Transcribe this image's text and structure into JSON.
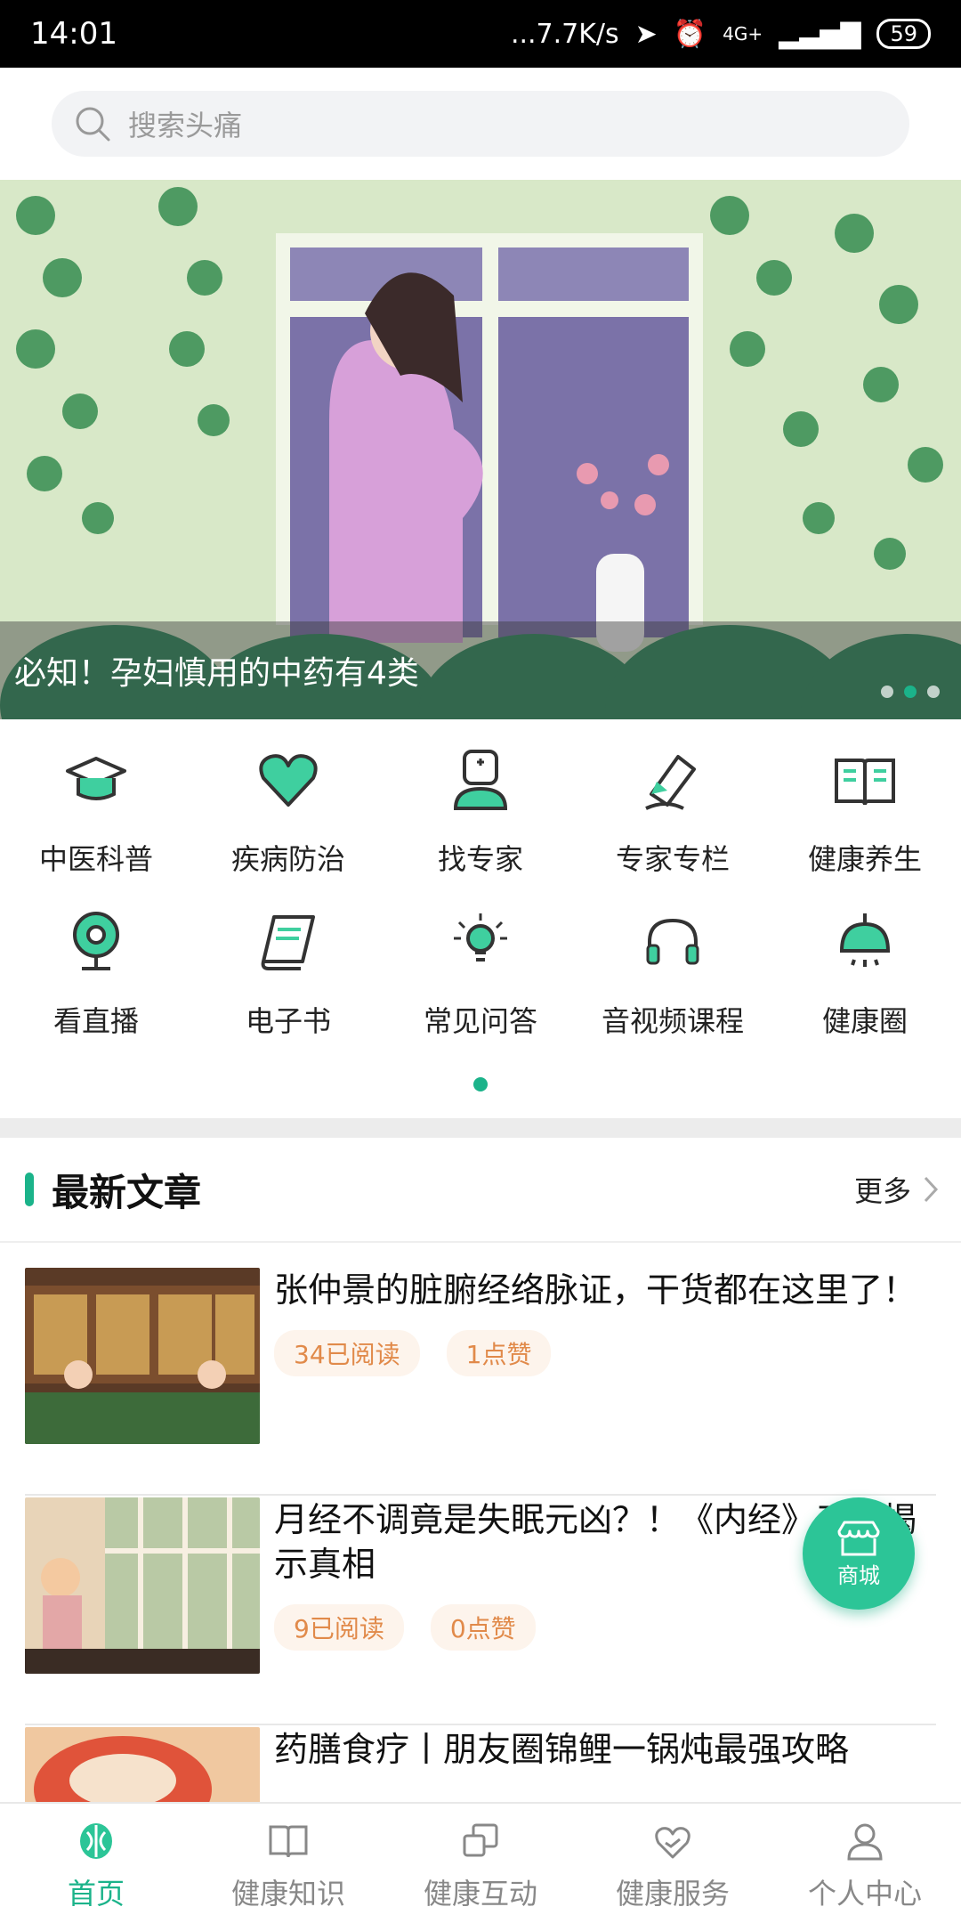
{
  "status_bar": {
    "time": "14:01",
    "network": "...7.7K/s",
    "signal": "4G+",
    "battery": "59"
  },
  "search": {
    "placeholder": "搜索头痛"
  },
  "banner": {
    "caption": "必知！孕妇慎用的中药有4类"
  },
  "categories": [
    {
      "label": "中医科普",
      "icon": "graduation-cap-icon"
    },
    {
      "label": "疾病防治",
      "icon": "heart-icon"
    },
    {
      "label": "找专家",
      "icon": "doctor-icon"
    },
    {
      "label": "专家专栏",
      "icon": "pen-icon"
    },
    {
      "label": "健康养生",
      "icon": "book-icon"
    },
    {
      "label": "看直播",
      "icon": "webcam-icon"
    },
    {
      "label": "电子书",
      "icon": "ebook-icon"
    },
    {
      "label": "常见问答",
      "icon": "lightbulb-icon"
    },
    {
      "label": "音视频课程",
      "icon": "headphones-icon"
    },
    {
      "label": "健康圈",
      "icon": "bell-lamp-icon"
    }
  ],
  "section": {
    "title": "最新文章",
    "more": "更多"
  },
  "articles": [
    {
      "title": "张仲景的脏腑经络脉证，干货都在这里了！",
      "reads": "34已阅读",
      "likes": "1点赞"
    },
    {
      "title": "月经不调竟是失眠元凶？！《内经》三法揭示真相",
      "reads": "9已阅读",
      "likes": "0点赞"
    },
    {
      "title": "药膳食疗丨朋友圈锦鲤一锅炖最强攻略"
    }
  ],
  "fab": {
    "label": "商城"
  },
  "tabbar": [
    {
      "label": "首页",
      "icon": "home-leaf-icon",
      "active": true
    },
    {
      "label": "健康知识",
      "icon": "open-book-icon"
    },
    {
      "label": "健康互动",
      "icon": "chat-squares-icon"
    },
    {
      "label": "健康服务",
      "icon": "heart-hand-icon"
    },
    {
      "label": "个人中心",
      "icon": "user-icon"
    }
  ],
  "colors": {
    "accent": "#1bb38a",
    "tag_text": "#e18a4a",
    "tag_bg": "#fdf4ec"
  }
}
